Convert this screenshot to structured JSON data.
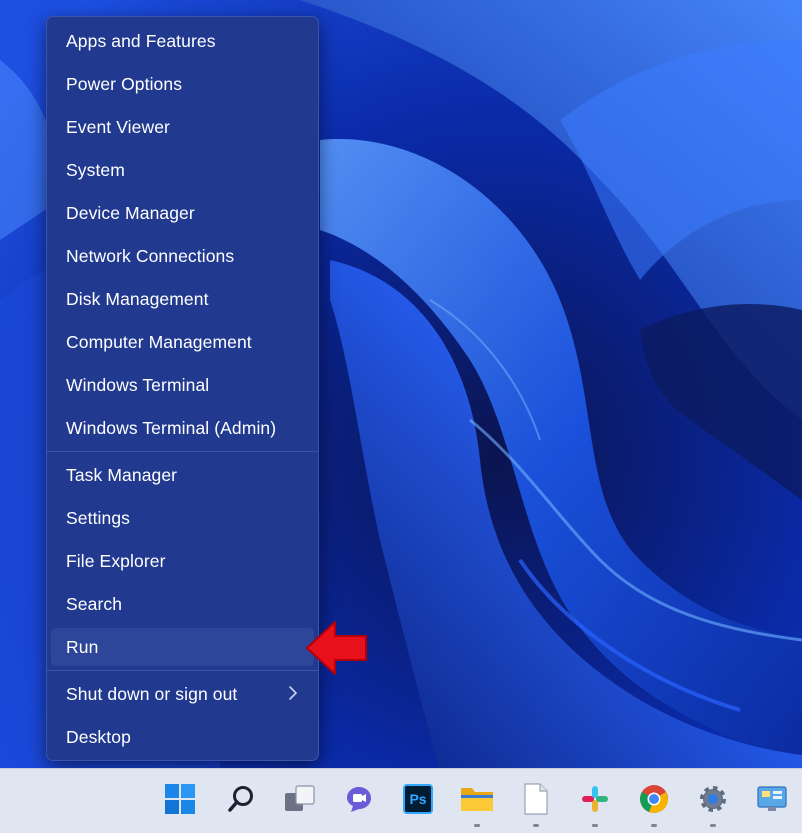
{
  "menu": {
    "items": [
      {
        "label": "Apps and Features"
      },
      {
        "label": "Power Options"
      },
      {
        "label": "Event Viewer"
      },
      {
        "label": "System"
      },
      {
        "label": "Device Manager"
      },
      {
        "label": "Network Connections"
      },
      {
        "label": "Disk Management"
      },
      {
        "label": "Computer Management"
      },
      {
        "label": "Windows Terminal"
      },
      {
        "label": "Windows Terminal (Admin)"
      },
      {
        "label": "Task Manager"
      },
      {
        "label": "Settings"
      },
      {
        "label": "File Explorer"
      },
      {
        "label": "Search"
      },
      {
        "label": "Run"
      },
      {
        "label": "Shut down or sign out"
      },
      {
        "label": "Desktop"
      }
    ],
    "highlighted_item": "Run",
    "submenu_item": "Shut down or sign out"
  },
  "colors": {
    "menu_bg": "#213a8f",
    "highlight_bg": "#2d4699",
    "callout_arrow": "#e8101a",
    "taskbar_bg": "#dfe6f1"
  },
  "taskbar": {
    "icons": [
      {
        "name": "start-icon"
      },
      {
        "name": "search-icon"
      },
      {
        "name": "task-view-icon"
      },
      {
        "name": "teams-chat-icon"
      },
      {
        "name": "photoshop-icon",
        "label": "Ps"
      },
      {
        "name": "file-explorer-icon"
      },
      {
        "name": "notepad-icon"
      },
      {
        "name": "slack-icon"
      },
      {
        "name": "chrome-icon"
      },
      {
        "name": "settings-icon"
      },
      {
        "name": "control-panel-icon"
      }
    ]
  }
}
